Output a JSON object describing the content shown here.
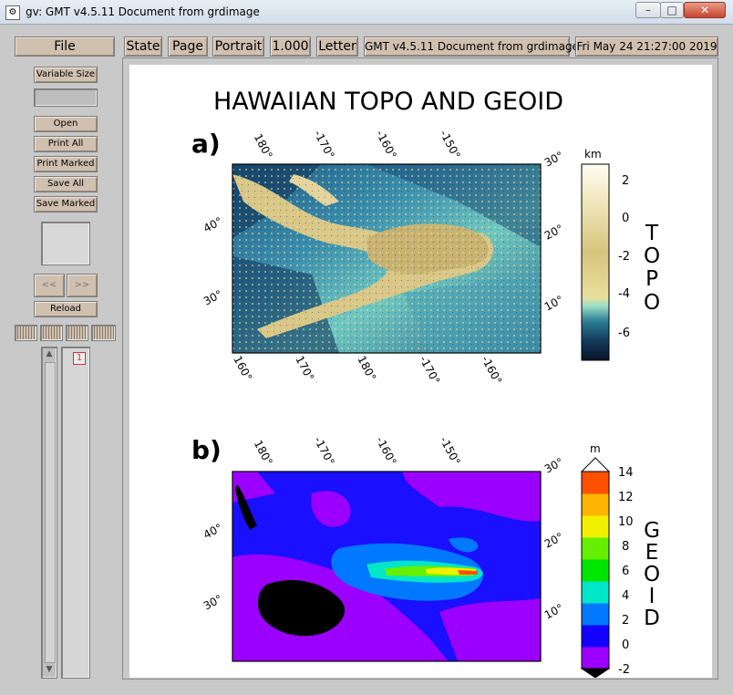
{
  "window": {
    "title": "gv: GMT v4.5.11 Document from grdimage",
    "minimize_label": "–",
    "maximize_label": "□",
    "close_label": "✕"
  },
  "toolbar": {
    "file": "File",
    "state": "State",
    "page": "Page",
    "orientation": "Portrait",
    "scale": "1.000",
    "media": "Letter",
    "doc_title": "GMT v4.5.11 Document from grdimage",
    "date": "Fri May 24 21:27:00 2019"
  },
  "sidebar": {
    "variable_size": "Variable Size",
    "open": "Open",
    "print_all": "Print All",
    "print_marked": "Print Marked",
    "save_all": "Save All",
    "save_marked": "Save Marked",
    "prev": "<<",
    "next": ">>",
    "reload": "Reload",
    "page_number": "1"
  },
  "figure": {
    "title": "HAWAIIAN TOPO AND GEOID",
    "panel_a_label": "a)",
    "panel_b_label": "b)",
    "top_ticks": [
      "180°",
      "-170°",
      "-160°",
      "-150°"
    ],
    "bottom_ticks": [
      "160°",
      "170°",
      "180°",
      "-170°",
      "-160°"
    ],
    "left_ticks": [
      "40°",
      "30°"
    ],
    "right_ticks": [
      "30°",
      "20°",
      "10°"
    ],
    "topo_unit": "km",
    "topo_ticks": [
      "2",
      "0",
      "-2",
      "-4",
      "-6"
    ],
    "topo_label": [
      "T",
      "O",
      "P",
      "O"
    ],
    "geoid_unit": "m",
    "geoid_ticks": [
      "14",
      "12",
      "10",
      "8",
      "6",
      "4",
      "2",
      "0",
      "-2"
    ],
    "geoid_label": [
      "G",
      "E",
      "O",
      "I",
      "D"
    ],
    "geoid_colors": [
      "#000000",
      "#9b00ff",
      "#1400ff",
      "#0078ff",
      "#00e6c8",
      "#00e600",
      "#64f000",
      "#f0f000",
      "#ffb400",
      "#ff5000"
    ]
  }
}
